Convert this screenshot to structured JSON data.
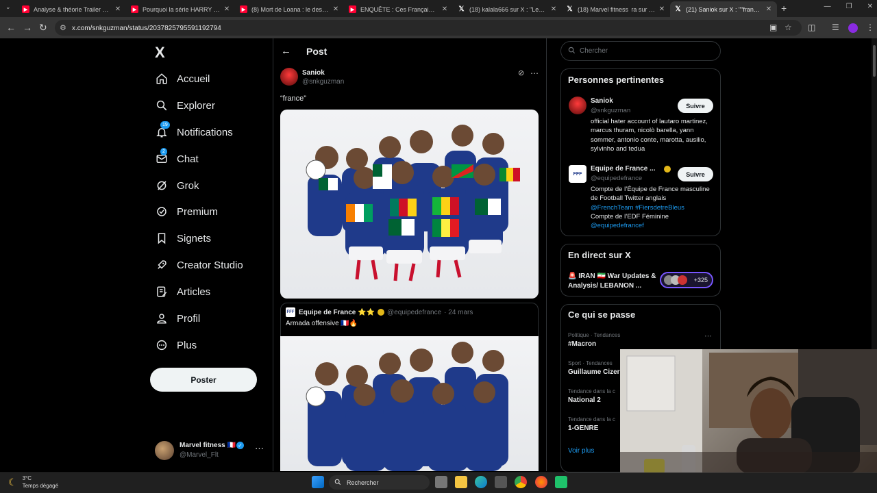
{
  "browser": {
    "tabs": [
      {
        "title": "Analyse & théorie Trailer 1 de l",
        "type": "youtube"
      },
      {
        "title": "Pourquoi la série HARRY POTTI",
        "type": "youtube"
      },
      {
        "title": "(8) Mort de Loana : le destin b",
        "type": "youtube"
      },
      {
        "title": "ENQUÊTE : Ces Français prêts à",
        "type": "youtube"
      },
      {
        "title": "(18) kalala666 sur X : \"Les rapp",
        "type": "x"
      },
      {
        "title": "(18) Marvel fitness  ra sur X : \"D",
        "type": "x"
      },
      {
        "title": "(21) Saniok sur X : \"\"france\" htt",
        "type": "x",
        "active": true
      }
    ],
    "url": "x.com/snkguzman/status/2037825795591192794"
  },
  "nav": {
    "logo": "X",
    "items": [
      {
        "label": "Accueil",
        "icon": "home-icon"
      },
      {
        "label": "Explorer",
        "icon": "search-icon"
      },
      {
        "label": "Notifications",
        "icon": "bell-icon",
        "badge": "19"
      },
      {
        "label": "Chat",
        "icon": "mail-icon",
        "badge": "2"
      },
      {
        "label": "Grok",
        "icon": "grok-icon"
      },
      {
        "label": "Premium",
        "icon": "premium-icon"
      },
      {
        "label": "Signets",
        "icon": "bookmark-icon"
      },
      {
        "label": "Creator Studio",
        "icon": "rocket-icon"
      },
      {
        "label": "Articles",
        "icon": "article-icon"
      },
      {
        "label": "Profil",
        "icon": "person-icon"
      },
      {
        "label": "Plus",
        "icon": "more-circle-icon"
      }
    ],
    "post_button": "Poster",
    "account": {
      "name": "Marvel fitness 🇫🇷",
      "handle": "@Marvel_Flt"
    }
  },
  "post": {
    "header": "Post",
    "author": {
      "name": "Saniok",
      "handle": "@snkguzman"
    },
    "text": "“france”",
    "quote": {
      "name": "Equipe de France ⭐⭐",
      "handle": "@equipedefrance",
      "date": "· 24 mars",
      "text": "Armada offensive 🇫🇷🔥"
    }
  },
  "right": {
    "search_placeholder": "Chercher",
    "relevant": {
      "title": "Personnes pertinentes",
      "people": [
        {
          "name": "Saniok",
          "handle": "@snkguzman",
          "follow": "Suivre",
          "bio": "official hater account of lautaro martinez, marcus thuram, nicolò barella, yann sommer, antonio conte, marotta, ausilio, sylvinho and tedua"
        },
        {
          "name": "Equipe de France ...",
          "handle": "@equipedefrance",
          "follow": "Suivre",
          "bio_line1": "Compte de l’Équipe de France masculine de Football Twitter anglais",
          "bio_link1": "@FrenchTeam #FiersdetreBleus",
          "bio_line2": "Compte de l’EDF Féminine",
          "bio_link2": "@equipedefrancef"
        }
      ]
    },
    "live": {
      "title": "En direct sur X",
      "item": "🚨 IRAN 🇮🇷 War Updates & Analysis/ LEBANON ...",
      "count": "+325"
    },
    "trends": {
      "title": "Ce qui se passe",
      "items": [
        {
          "meta": "Politique · Tendances",
          "name": "#Macron"
        },
        {
          "meta": "Sport · Tendances",
          "name": "Guillaume Cizer"
        },
        {
          "meta": "Tendance dans la c",
          "name": "National 2"
        },
        {
          "meta": "Tendance dans la c",
          "name": "1-GENRE"
        }
      ],
      "more": "Voir plus"
    }
  },
  "taskbar": {
    "temp": "3°C",
    "weather": "Temps dégagé",
    "search": "Rechercher"
  }
}
